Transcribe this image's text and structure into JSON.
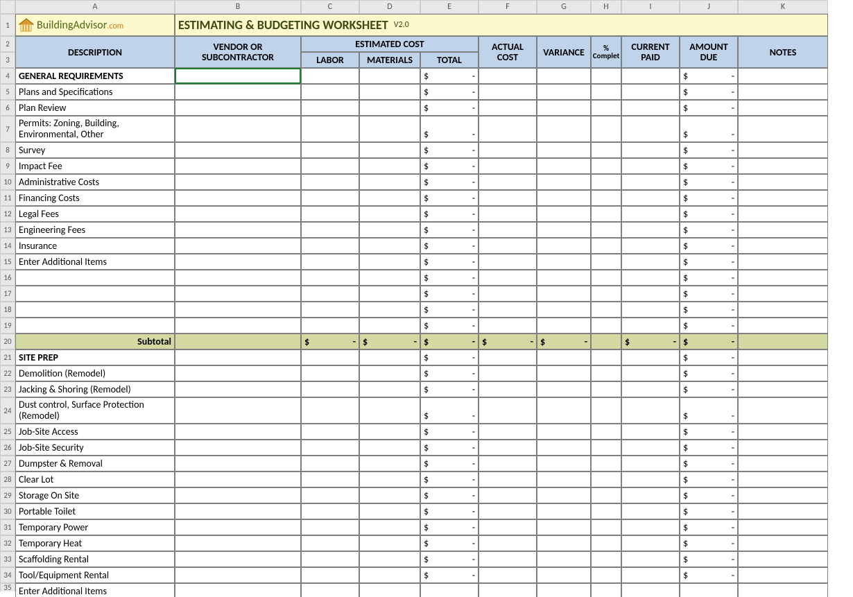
{
  "columns": [
    "A",
    "B",
    "C",
    "D",
    "E",
    "F",
    "G",
    "H",
    "I",
    "J",
    "K"
  ],
  "logo": {
    "text": "BuildingAdvisor",
    "suffix": ".com"
  },
  "title": {
    "main": "ESTIMATING & BUDGETING WORKSHEET",
    "ver": "V2.0"
  },
  "headers": {
    "description": "DESCRIPTION",
    "vendor": "VENDOR  OR SUBCONTRACTOR",
    "estimated": "ESTIMATED COST",
    "labor": "LABOR",
    "materials": "MATERIALS",
    "total": "TOTAL",
    "actual": "ACTUAL COST",
    "variance": "VARIANCE",
    "pct": "% Complet",
    "paid": "CURRENT PAID",
    "amount": "AMOUNT DUE",
    "notes": "NOTES"
  },
  "dollar": "$",
  "dash": "-",
  "subtotal_label": "Subtotal",
  "rows": [
    {
      "n": 4,
      "type": "section",
      "desc": "GENERAL REQUIREMENTS",
      "selected": true
    },
    {
      "n": 5,
      "type": "item",
      "desc": "Plans and Specifications"
    },
    {
      "n": 6,
      "type": "item",
      "desc": "Plan Review"
    },
    {
      "n": 7,
      "type": "item",
      "desc": "Permits: Zoning, Building, Environmental, Other",
      "tall": true
    },
    {
      "n": 8,
      "type": "item",
      "desc": "Survey"
    },
    {
      "n": 9,
      "type": "item",
      "desc": "Impact Fee"
    },
    {
      "n": 10,
      "type": "item",
      "desc": "Administrative Costs"
    },
    {
      "n": 11,
      "type": "item",
      "desc": "Financing Costs"
    },
    {
      "n": 12,
      "type": "item",
      "desc": "Legal Fees"
    },
    {
      "n": 13,
      "type": "item",
      "desc": "Engineering Fees"
    },
    {
      "n": 14,
      "type": "item",
      "desc": "Insurance"
    },
    {
      "n": 15,
      "type": "item",
      "desc": "Enter Additional Items"
    },
    {
      "n": 16,
      "type": "item",
      "desc": ""
    },
    {
      "n": 17,
      "type": "item",
      "desc": ""
    },
    {
      "n": 18,
      "type": "item",
      "desc": ""
    },
    {
      "n": 19,
      "type": "item",
      "desc": ""
    },
    {
      "n": 20,
      "type": "subtotal"
    },
    {
      "n": 21,
      "type": "section",
      "desc": "SITE PREP"
    },
    {
      "n": 22,
      "type": "item",
      "desc": "Demolition (Remodel)"
    },
    {
      "n": 23,
      "type": "item",
      "desc": "Jacking & Shoring (Remodel)"
    },
    {
      "n": 24,
      "type": "item",
      "desc": "Dust control, Surface Protection (Remodel)",
      "tall": true
    },
    {
      "n": 25,
      "type": "item",
      "desc": "Job-Site Access"
    },
    {
      "n": 26,
      "type": "item",
      "desc": "Job-Site Security"
    },
    {
      "n": 27,
      "type": "item",
      "desc": "Dumpster & Removal"
    },
    {
      "n": 28,
      "type": "item",
      "desc": "Clear Lot"
    },
    {
      "n": 29,
      "type": "item",
      "desc": "Storage On Site"
    },
    {
      "n": 30,
      "type": "item",
      "desc": "Portable Toilet"
    },
    {
      "n": 31,
      "type": "item",
      "desc": "Temporary Power"
    },
    {
      "n": 32,
      "type": "item",
      "desc": "Temporary Heat"
    },
    {
      "n": 33,
      "type": "item",
      "desc": "Scaffolding Rental"
    },
    {
      "n": 34,
      "type": "item",
      "desc": "Tool/Equipment Rental"
    },
    {
      "n": 35,
      "type": "cut",
      "desc": "Enter Additional Items"
    }
  ]
}
